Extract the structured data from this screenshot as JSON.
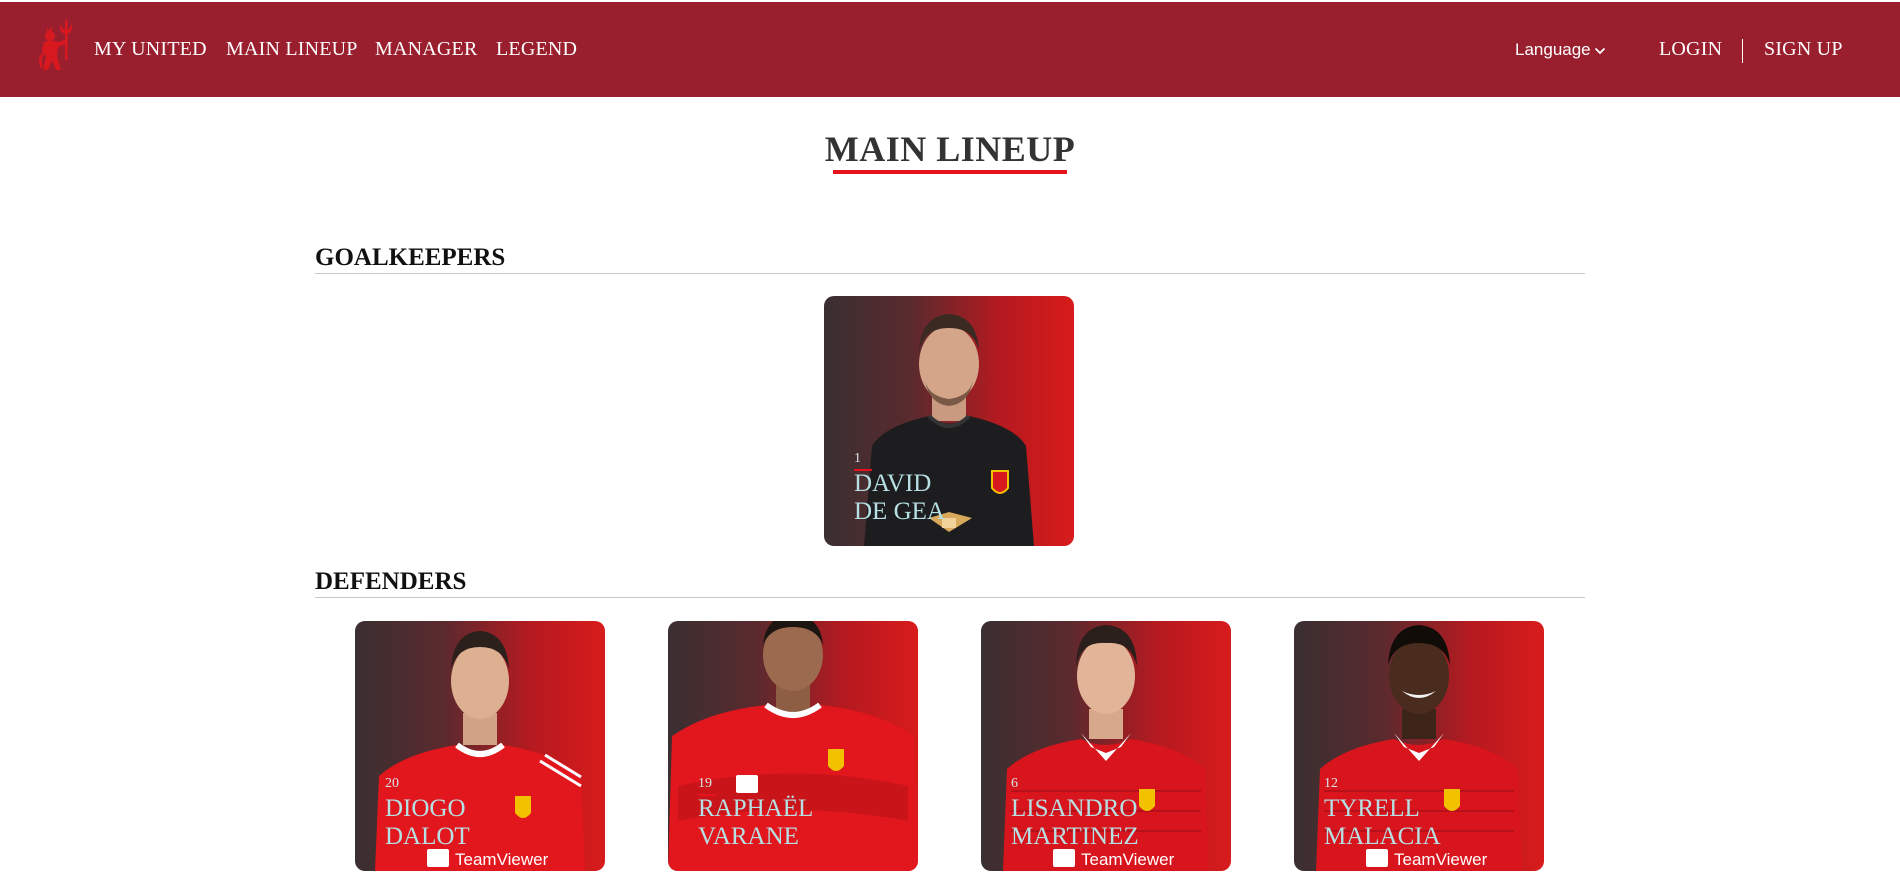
{
  "nav": {
    "items": [
      {
        "label": "MY UNITED"
      },
      {
        "label": "MAIN LINEUP"
      },
      {
        "label": "MANAGER"
      },
      {
        "label": "LEGEND"
      }
    ],
    "language_label": "Language",
    "login_label": "LOGIN",
    "signup_label": "SIGN UP"
  },
  "page": {
    "title": "MAIN LINEUP"
  },
  "sections": [
    {
      "title": "GOALKEEPERS",
      "players": [
        {
          "number": "1",
          "first": "DAVID",
          "last": "DE GEA",
          "kit": "goalkeeper"
        }
      ]
    },
    {
      "title": "DEFENDERS",
      "players": [
        {
          "number": "20",
          "first": "DIOGO",
          "last": "DALOT",
          "kit": "home-2021"
        },
        {
          "number": "19",
          "first": "RAPHAËL",
          "last": "VARANE",
          "kit": "home-2021"
        },
        {
          "number": "6",
          "first": "LISANDRO",
          "last": "MARTINEZ",
          "kit": "home-2022"
        },
        {
          "number": "12",
          "first": "TYRELL",
          "last": "MALACIA",
          "kit": "home-2022"
        }
      ]
    }
  ],
  "colors": {
    "header_bg": "#9a1f2e",
    "accent_red": "#e5141c",
    "card_name": "#b6e0e3"
  },
  "icons": {
    "logo": "red-devil-logo-icon",
    "language_caret": "chevron-down-icon"
  },
  "sponsor_text": "TeamViewer"
}
